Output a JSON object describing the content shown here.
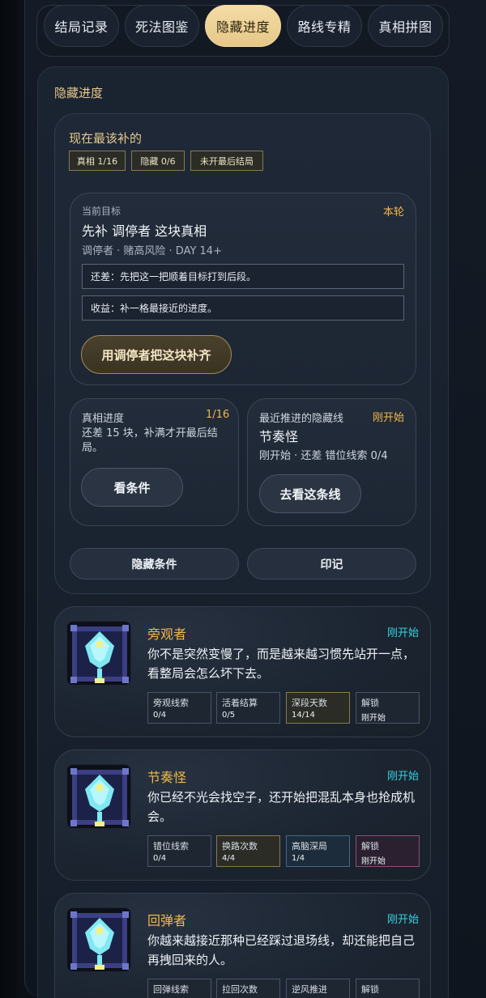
{
  "tabs": [
    {
      "label": "结局记录"
    },
    {
      "label": "死法图鉴"
    },
    {
      "label": "隐藏进度",
      "active": true
    },
    {
      "label": "路线专精"
    },
    {
      "label": "真相拼图"
    }
  ],
  "panel": {
    "title": "隐藏进度"
  },
  "priority": {
    "title": "现在最该补的",
    "chips": [
      "真相 1/16",
      "隐藏 0/6",
      "未开最后结局"
    ],
    "goal": {
      "label": "当前目标",
      "tag": "本轮",
      "headline": "先补 调停者 这块真相",
      "meta": "调停者 · 赌高风险 · DAY 14+",
      "remaining": "还差：先把这一把顺着目标打到后段。",
      "reward": "收益：补一格最接近的进度。",
      "action": "用调停者把这块补齐"
    },
    "truth": {
      "label": "真相进度",
      "count": "1/16",
      "desc": "还差 15 块，补满才开最后结局。",
      "action": "看条件"
    },
    "recent": {
      "label": "最近推进的隐藏线",
      "status": "刚开始",
      "name": "节奏怪",
      "desc": "刚开始 · 还差 错位线索 0/4",
      "action": "去看这条线"
    },
    "footer_buttons": [
      "隐藏条件",
      "印记"
    ]
  },
  "personas": [
    {
      "name": "旁观者",
      "status": "刚开始",
      "desc": "你不是突然变慢了，而是越来越习惯先站开一点，看整局会怎么坏下去。",
      "stats": [
        {
          "label": "旁观线索",
          "value": "0/4",
          "style": ""
        },
        {
          "label": "活着结算",
          "value": "0/5",
          "style": ""
        },
        {
          "label": "深段天数",
          "value": "14/14",
          "style": "gold"
        },
        {
          "label": "解锁",
          "value": "刚开始",
          "style": ""
        }
      ]
    },
    {
      "name": "节奏怪",
      "status": "刚开始",
      "desc": "你已经不光会找空子，还开始把混乱本身也抢成机会。",
      "stats": [
        {
          "label": "错位线索",
          "value": "0/4",
          "style": ""
        },
        {
          "label": "换路次数",
          "value": "4/4",
          "style": "gold"
        },
        {
          "label": "高脑深局",
          "value": "1/4",
          "style": "blue"
        },
        {
          "label": "解锁",
          "value": "刚开始",
          "style": "pink"
        }
      ]
    },
    {
      "name": "回弹者",
      "status": "刚开始",
      "desc": "你越来越接近那种已经踩过退场线，却还能把自己再拽回来的人。",
      "stats": [
        {
          "label": "回弹线索",
          "value": "",
          "style": ""
        },
        {
          "label": "拉回次数",
          "value": "",
          "style": ""
        },
        {
          "label": "逆风推进",
          "value": "",
          "style": ""
        },
        {
          "label": "解锁",
          "value": "",
          "style": ""
        }
      ]
    }
  ]
}
